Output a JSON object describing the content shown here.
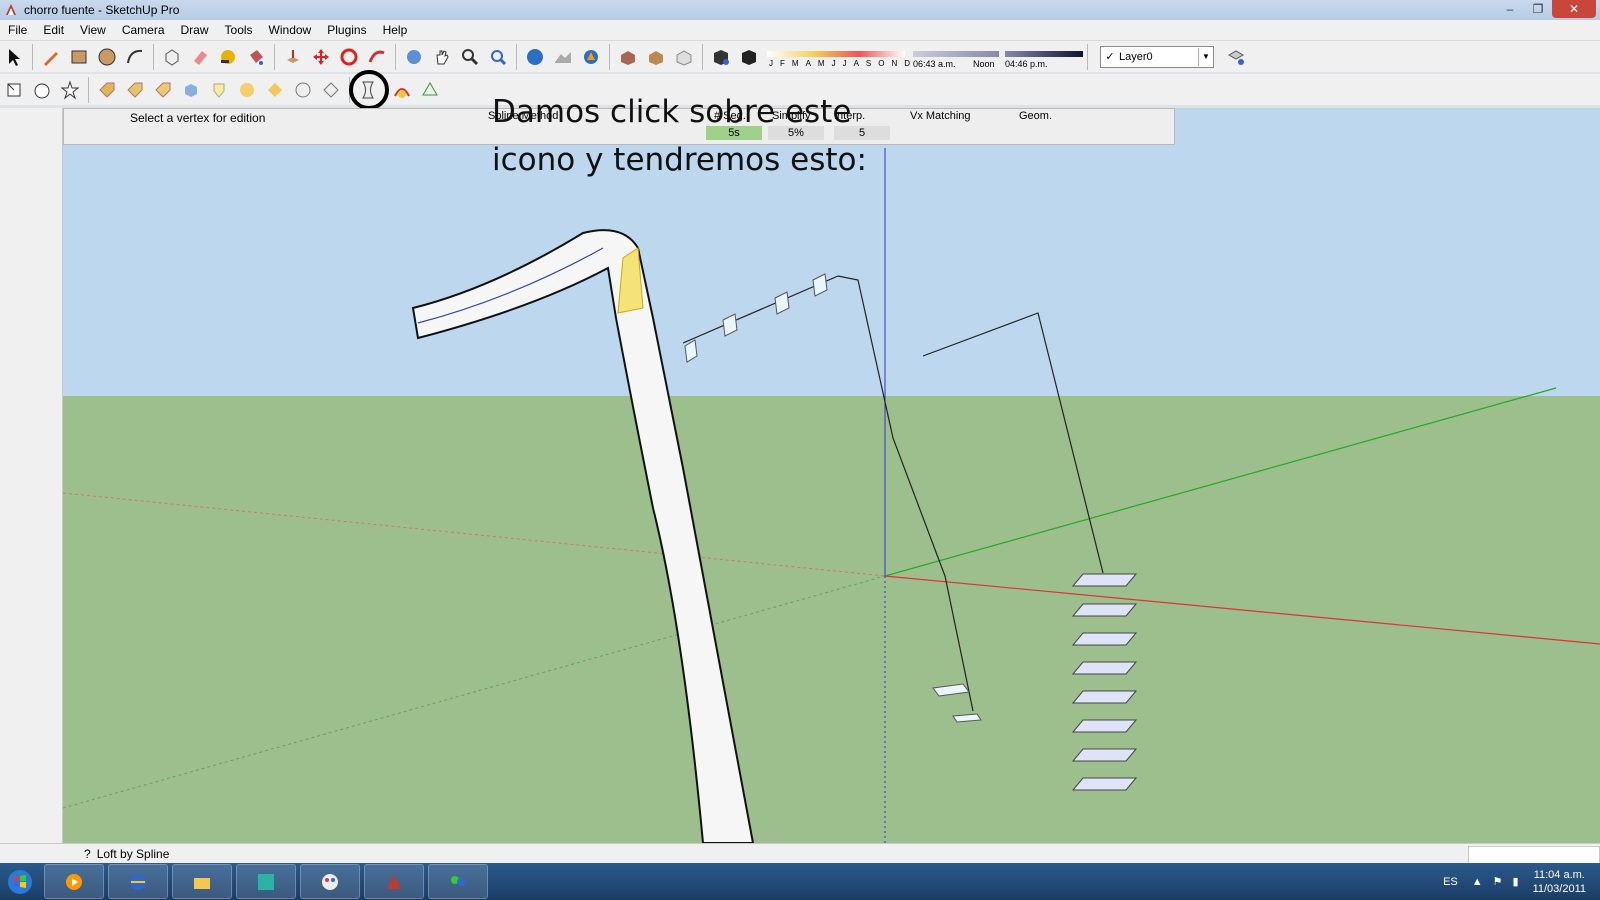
{
  "window": {
    "title": "chorro fuente - SketchUp Pro",
    "minimize": "–",
    "maximize": "❐",
    "close": "✕"
  },
  "menu": [
    "File",
    "Edit",
    "View",
    "Camera",
    "Draw",
    "Tools",
    "Window",
    "Plugins",
    "Help"
  ],
  "shadows": {
    "months": [
      "J",
      "F",
      "M",
      "A",
      "M",
      "J",
      "J",
      "A",
      "S",
      "O",
      "N",
      "D"
    ],
    "time_start": "06:43 a.m.",
    "time_mid": "Noon",
    "time_end": "04:46 p.m."
  },
  "layer": {
    "name": "Layer0"
  },
  "spline_toolbar": {
    "prompt": "Select a vertex for edition",
    "spline_method": "Spline Method",
    "seg": "# Seg.",
    "seg_value": "5s",
    "simplify": "Simplify",
    "simplify_value": "5%",
    "interp": "Interp.",
    "interp_value": "5",
    "vx_matching": "Vx Matching",
    "geom": "Geom."
  },
  "annotation": {
    "line1": "Damos click sobre este",
    "line2": "icono y tendremos esto:"
  },
  "status": {
    "text": "Loft by Spline"
  },
  "taskbar": {
    "lang": "ES",
    "time": "11:04 a.m.",
    "date": "11/03/2011"
  },
  "colors": {
    "sky": "#bcd7ee",
    "ground": "#9dbf8e",
    "red_axis": "#d33",
    "green_axis": "#2a2",
    "blue_axis": "#33c"
  }
}
